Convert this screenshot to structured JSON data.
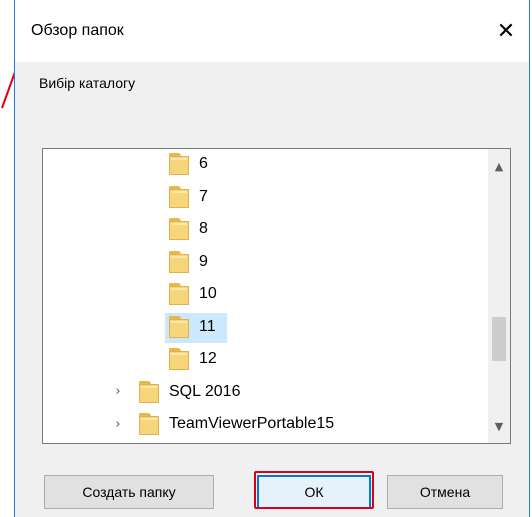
{
  "dialog": {
    "title": "Обзор папок",
    "close_glyph": "✕",
    "subtitle": "Вибір каталогу"
  },
  "tree": {
    "items": [
      {
        "label": "6",
        "level": 2,
        "expandable": false,
        "selected": false
      },
      {
        "label": "7",
        "level": 2,
        "expandable": false,
        "selected": false
      },
      {
        "label": "8",
        "level": 2,
        "expandable": false,
        "selected": false
      },
      {
        "label": "9",
        "level": 2,
        "expandable": false,
        "selected": false
      },
      {
        "label": "10",
        "level": 2,
        "expandable": false,
        "selected": false
      },
      {
        "label": "11",
        "level": 2,
        "expandable": false,
        "selected": true
      },
      {
        "label": "12",
        "level": 2,
        "expandable": false,
        "selected": false
      },
      {
        "label": "SQL 2016",
        "level": 1,
        "expandable": true,
        "selected": false
      },
      {
        "label": "TeamViewerPortable15",
        "level": 1,
        "expandable": true,
        "selected": false
      }
    ],
    "chevron_glyph": "›",
    "scroll_up_glyph": "▲",
    "scroll_down_glyph": "▼",
    "scroll_position": 0.72
  },
  "buttons": {
    "new_folder": "Создать папку",
    "ok": "ОК",
    "cancel": "Отмена"
  },
  "annotation": {
    "highlight_color": "#d8001c",
    "arrow_color": "#e00010"
  },
  "icons": {
    "folder": "folder-icon",
    "close": "close-icon",
    "chevron": "chevron-right-icon"
  }
}
